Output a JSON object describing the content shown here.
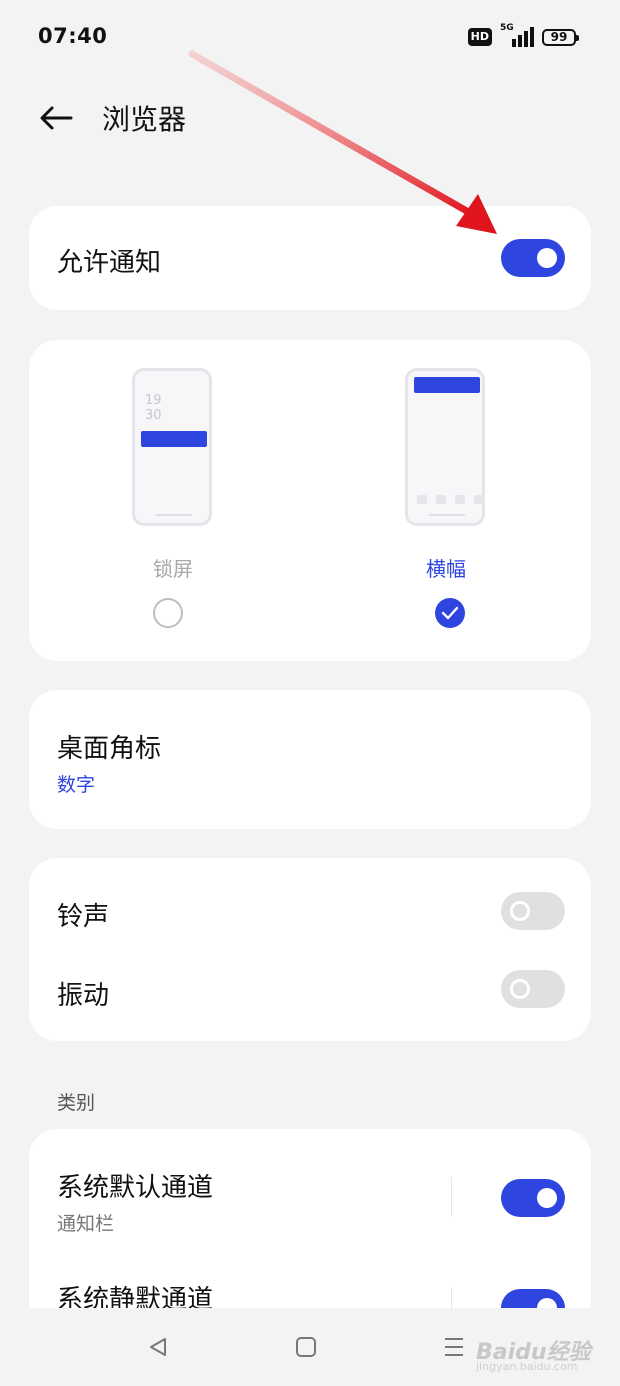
{
  "status": {
    "time": "07:40",
    "hd": "HD",
    "network": "5G",
    "battery": "99"
  },
  "header": {
    "title": "浏览器"
  },
  "notifications": {
    "allow_label": "允许通知",
    "allow_on": true
  },
  "style_picker": {
    "lockscreen": {
      "label": "锁屏",
      "clock": [
        "19",
        "30"
      ],
      "selected": false
    },
    "banner": {
      "label": "横幅",
      "selected": true
    }
  },
  "badge": {
    "label": "桌面角标",
    "value": "数字"
  },
  "sound": {
    "ringtone_label": "铃声",
    "ringtone_on": false,
    "vibrate_label": "振动",
    "vibrate_on": false
  },
  "category": {
    "header": "类别",
    "items": [
      {
        "label": "系统默认通道",
        "sub": "通知栏",
        "on": true
      },
      {
        "label": "系统静默通道",
        "on": true
      }
    ]
  },
  "watermark": {
    "brand": "Baidu经验",
    "url": "jingyan.baidu.com"
  },
  "colors": {
    "accent": "#2f45e0",
    "annotation_arrow": "#e0141c"
  }
}
